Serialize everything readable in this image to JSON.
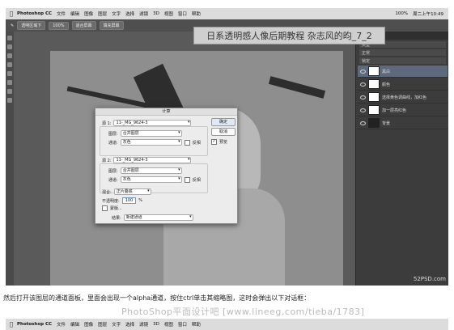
{
  "menubar": {
    "apple": "",
    "app_name": "Photoshop CC",
    "menus": [
      "文件",
      "编辑",
      "图像",
      "图层",
      "文字",
      "选择",
      "滤镜",
      "3D",
      "视图",
      "窗口",
      "帮助"
    ],
    "clock": "周二上午10:49",
    "zoom": "100%"
  },
  "options_bar": {
    "tool": "画笔工具",
    "mode": "透明区域下",
    "chip1": "100%",
    "chip2": "适合屏幕",
    "chip3": "填充屏幕"
  },
  "title_overlay": "日系透明感人像后期教程 杂志风的昀_7_2",
  "layers_panel": {
    "tab": "图层",
    "kind": "类型",
    "blend": "正常",
    "opacity_label": "不透明度",
    "lock_label": "锁定",
    "fill_label": "填充",
    "layers": [
      {
        "name": "黑白"
      },
      {
        "name": "颜色"
      },
      {
        "name": "选择黄色调曲线，加红色"
      },
      {
        "name": "加一层亮红色"
      },
      {
        "name": "背景"
      }
    ]
  },
  "dialog": {
    "title": "计算",
    "source1_label": "源 1:",
    "source1_value": "11-_MG_9624-3",
    "layer1_label": "图层:",
    "layer1_value": "合并图层",
    "channel1_label": "通道:",
    "channel1_value": "灰色",
    "invert1_label": "反相",
    "source2_label": "源 2:",
    "source2_value": "11-_MG_9624-3",
    "layer2_label": "图层:",
    "layer2_value": "合并图层",
    "channel2_label": "通道:",
    "channel2_value": "灰色",
    "invert2_label": "反相",
    "blending_label": "混合:",
    "blending_value": "正片叠底",
    "opacity_label": "不透明度:",
    "opacity_value": "100",
    "opacity_unit": "%",
    "mask_label": "蒙版...",
    "result_label": "结果:",
    "result_value": "新建通道",
    "ok": "确定",
    "cancel": "取消",
    "preview": "预览"
  },
  "canvas_watermark": "52PSD.com",
  "caption": "然后打开该图层的通道面板，里面会出现一个alpha通道，按住ctrl单击其缩略图，这时会弹出以下对话框：",
  "site_watermark": "PhotoShop平面设计吧  [www.lineeg.com/tieba/1783]",
  "second_shot": {
    "app_name": "Photoshop CC",
    "menus": [
      "文件",
      "编辑",
      "图像",
      "图层",
      "文字",
      "选择",
      "滤镜",
      "3D",
      "视图",
      "窗口",
      "帮助"
    ]
  }
}
